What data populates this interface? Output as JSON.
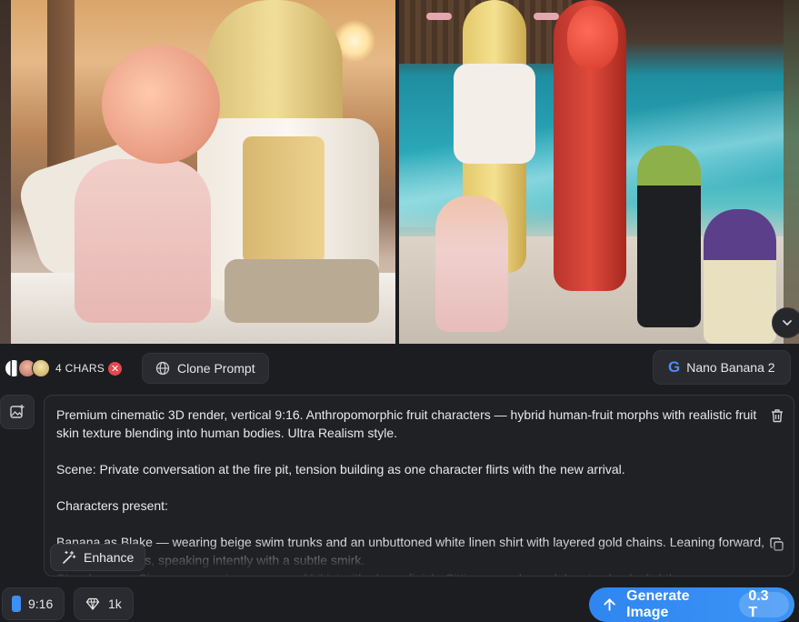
{
  "characters": {
    "label": "4 CHARS",
    "remove_icon": "close-icon"
  },
  "clone_prompt": {
    "label": "Clone Prompt",
    "icon": "globe-icon"
  },
  "model": {
    "label": "Nano Banana 2",
    "logo": "G"
  },
  "prompt": {
    "text": "Premium cinematic 3D render, vertical 9:16. Anthropomorphic fruit characters — hybrid human-fruit morphs with realistic fruit skin texture blending into human bodies. Ultra Realism style.\n\nScene: Private conversation at the fire pit, tension building as one character flirts with the new arrival.\n\nCharacters present:\n\nBanana as Blake — wearing beige swim trunks and an unbuttoned white linen shirt with layered gold chains. Leaning forward, elbows on knees, speaking intently with a subtle smirk.\nStrawberry as Sienna — wearing a neon red bikini with glossy finish. Sitting cross-legged, leaning back slightly"
  },
  "enhance": {
    "label": "Enhance"
  },
  "aspect_ratio": {
    "label": "9:16"
  },
  "resolution": {
    "label": "1k"
  },
  "generate": {
    "label": "Generate Image",
    "cost": "0.3 T"
  },
  "colors": {
    "accent": "#3c93f5",
    "background": "#1c1d21",
    "danger": "#e5484d"
  }
}
